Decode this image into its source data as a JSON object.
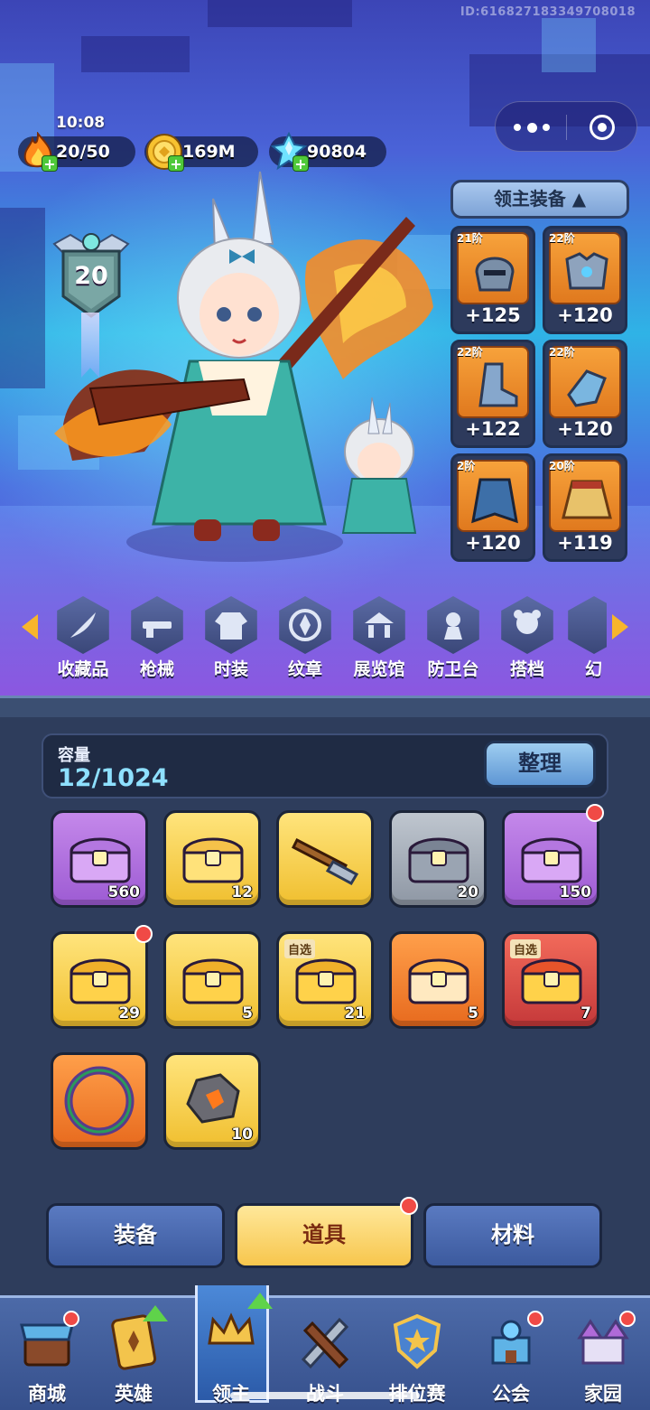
{
  "header": {
    "game_id": "ID:616827183349708018",
    "time": "10:08",
    "stamina": "20/50",
    "gold": "169M",
    "crystals": "90804",
    "level": "20"
  },
  "equipment": {
    "title": "领主装备",
    "slots": [
      {
        "tier": "21阶",
        "bonus": "+125",
        "icon": "helmet-icon"
      },
      {
        "tier": "22阶",
        "bonus": "+120",
        "icon": "chest-armor-icon"
      },
      {
        "tier": "22阶",
        "bonus": "+122",
        "icon": "boots-icon"
      },
      {
        "tier": "22阶",
        "bonus": "+120",
        "icon": "gauntlet-icon"
      },
      {
        "tier": "2阶",
        "bonus": "+120",
        "icon": "cape-icon"
      },
      {
        "tier": "20阶",
        "bonus": "+119",
        "icon": "skirt-icon"
      }
    ]
  },
  "categories": [
    "收藏品",
    "枪械",
    "时装",
    "纹章",
    "展览馆",
    "防卫台",
    "搭档",
    "幻"
  ],
  "bag": {
    "capacity_label": "容量",
    "capacity_value": "12/1024",
    "sort_label": "整理",
    "items": [
      {
        "color": "purple",
        "count": "560",
        "tag": "",
        "dot": false,
        "icon": "purple-chest-icon"
      },
      {
        "color": "gold",
        "count": "12",
        "tag": "",
        "dot": false,
        "icon": "winged-lock-chest-icon"
      },
      {
        "color": "gold",
        "count": "",
        "tag": "",
        "dot": false,
        "icon": "rifle-icon"
      },
      {
        "color": "gray",
        "count": "20",
        "tag": "",
        "dot": false,
        "icon": "iron-chest-icon"
      },
      {
        "color": "purple",
        "count": "150",
        "tag": "",
        "dot": true,
        "icon": "purple-chest-icon"
      },
      {
        "color": "gold",
        "count": "29",
        "tag": "",
        "dot": true,
        "icon": "gold-chest-icon"
      },
      {
        "color": "gold",
        "count": "5",
        "tag": "",
        "dot": false,
        "icon": "winged-gold-chest-icon"
      },
      {
        "color": "gold",
        "count": "21",
        "tag": "自选",
        "dot": false,
        "icon": "select-chest-icon"
      },
      {
        "color": "orange",
        "count": "5",
        "tag": "",
        "dot": false,
        "icon": "winged-orange-chest-icon"
      },
      {
        "color": "red",
        "count": "7",
        "tag": "自选",
        "dot": false,
        "icon": "select-red-chest-icon"
      },
      {
        "color": "orange",
        "count": "",
        "tag": "",
        "dot": false,
        "icon": "portal-ring-icon"
      },
      {
        "color": "gold",
        "count": "10",
        "tag": "",
        "dot": false,
        "icon": "ore-icon"
      }
    ]
  },
  "tabs": [
    "装备",
    "道具",
    "材料"
  ],
  "nav": [
    "商城",
    "英雄",
    "领主",
    "战斗",
    "排位赛",
    "公会",
    "家园"
  ],
  "colors": {
    "panel": "#2e3d5c",
    "accent_gold": "#f7c64d",
    "badge_red": "#f04a46",
    "nav_bg": "#4c6aa8"
  }
}
